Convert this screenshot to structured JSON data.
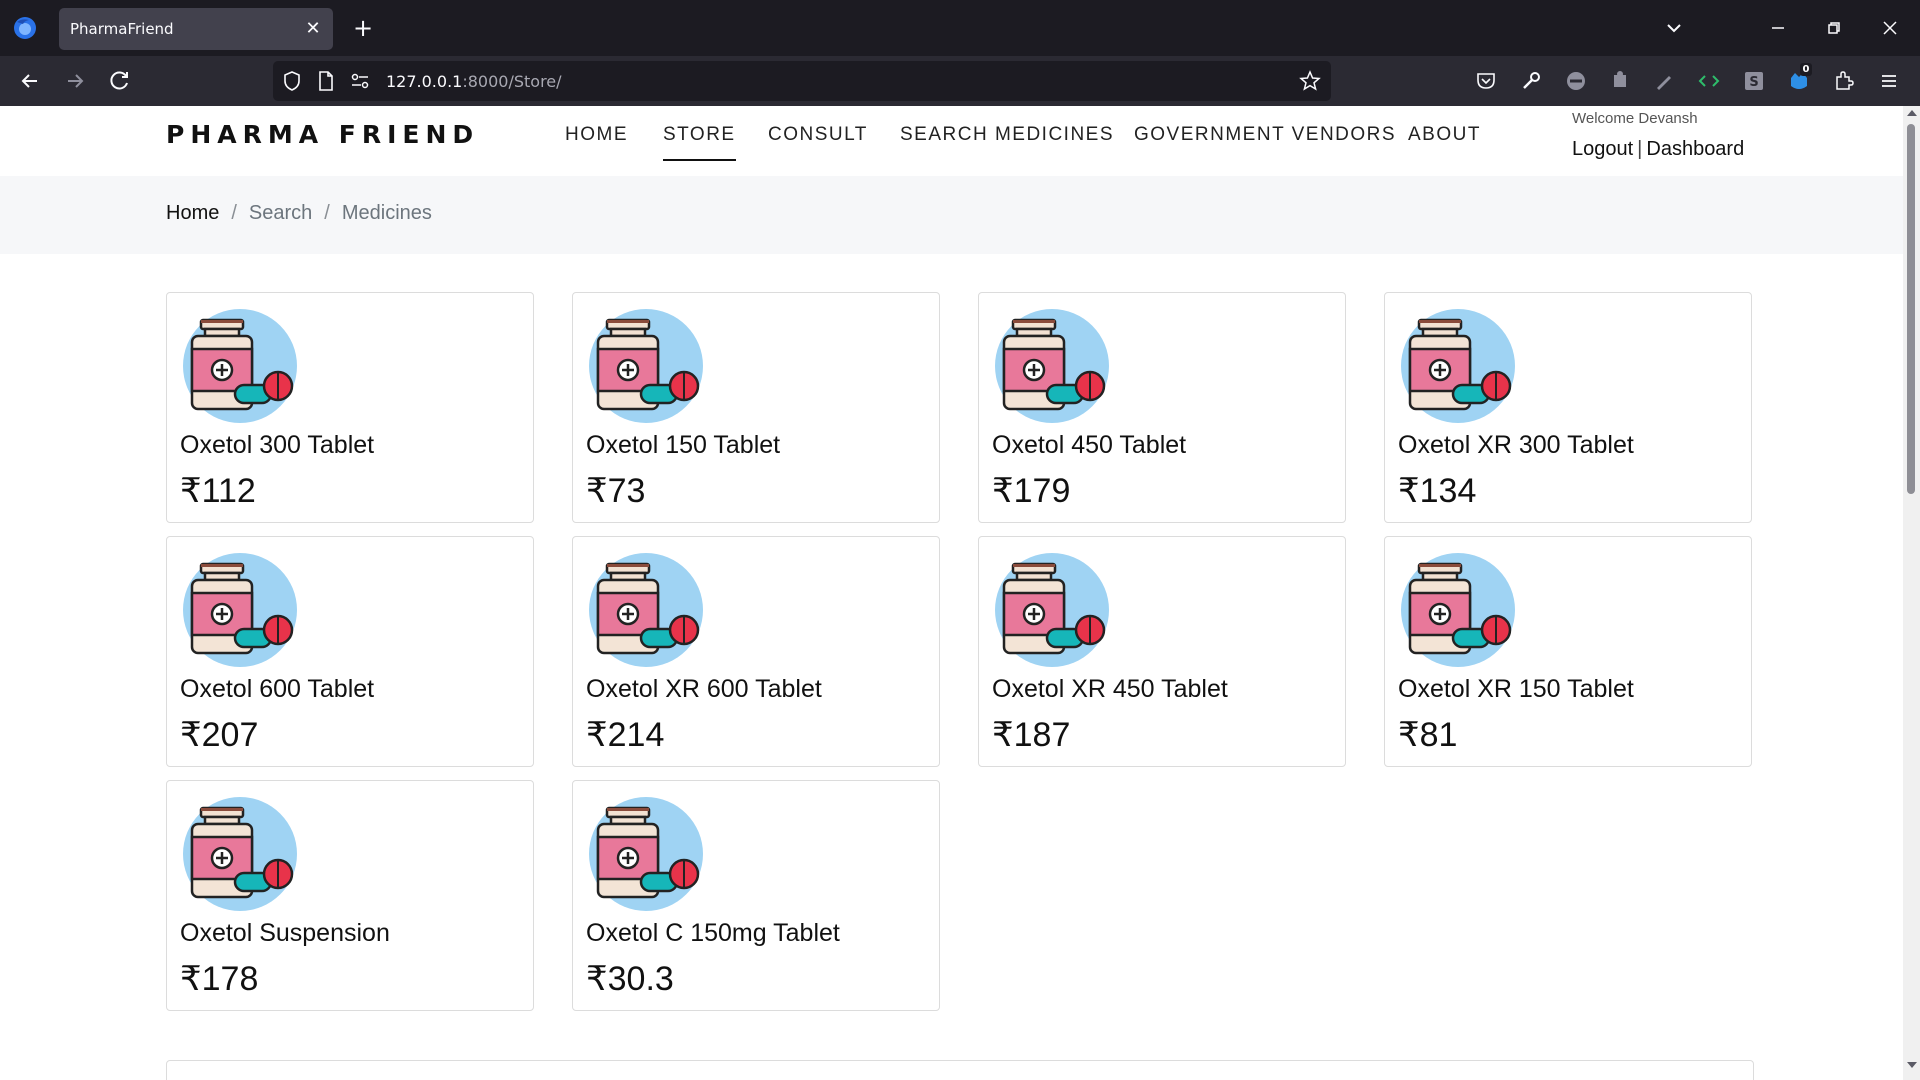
{
  "browser": {
    "tab_title": "PharmaFriend",
    "tab_close_glyph": "✕",
    "new_tab_glyph": "+",
    "url_host": "127.0.0.1",
    "url_rest": ":8000/Store/",
    "extension_badge": "0"
  },
  "header": {
    "brand": "PHARMA FRIEND",
    "nav": [
      {
        "label": "HOME",
        "active": false
      },
      {
        "label": "STORE",
        "active": true
      },
      {
        "label": "CONSULT",
        "active": false
      },
      {
        "label": "SEARCH MEDICINES",
        "active": false
      },
      {
        "label": "GOVERNMENT VENDORS",
        "active": false
      },
      {
        "label": "ABOUT",
        "active": false
      }
    ],
    "welcome": "Welcome Devansh",
    "logout": "Logout",
    "separator": "|",
    "dashboard": "Dashboard"
  },
  "breadcrumb": {
    "items": [
      "Home",
      "Search",
      "Medicines"
    ],
    "separator": "/"
  },
  "products": [
    {
      "name": "Oxetol 300 Tablet",
      "price": "₹112"
    },
    {
      "name": "Oxetol 150 Tablet",
      "price": "₹73"
    },
    {
      "name": "Oxetol 450 Tablet",
      "price": "₹179"
    },
    {
      "name": "Oxetol XR 300 Tablet",
      "price": "₹134"
    },
    {
      "name": "Oxetol 600 Tablet",
      "price": "₹207"
    },
    {
      "name": "Oxetol XR 600 Tablet",
      "price": "₹214"
    },
    {
      "name": "Oxetol XR 450 Tablet",
      "price": "₹187"
    },
    {
      "name": "Oxetol XR 150 Tablet",
      "price": "₹81"
    },
    {
      "name": "Oxetol Suspension",
      "price": "₹178"
    },
    {
      "name": "Oxetol C 150mg Tablet",
      "price": "₹30.3"
    }
  ],
  "product_icon": "medicine-bottle-icon",
  "colors": {
    "tab_bar": "#1c1b22",
    "nav_bar": "#2b2a33",
    "breadcrumb_bg": "#f6f7f9",
    "icon_circle": "#9fd3f3",
    "bottle_label": "#e8789a",
    "pill_teal": "#16b6b9",
    "pill_red": "#e8334a"
  }
}
